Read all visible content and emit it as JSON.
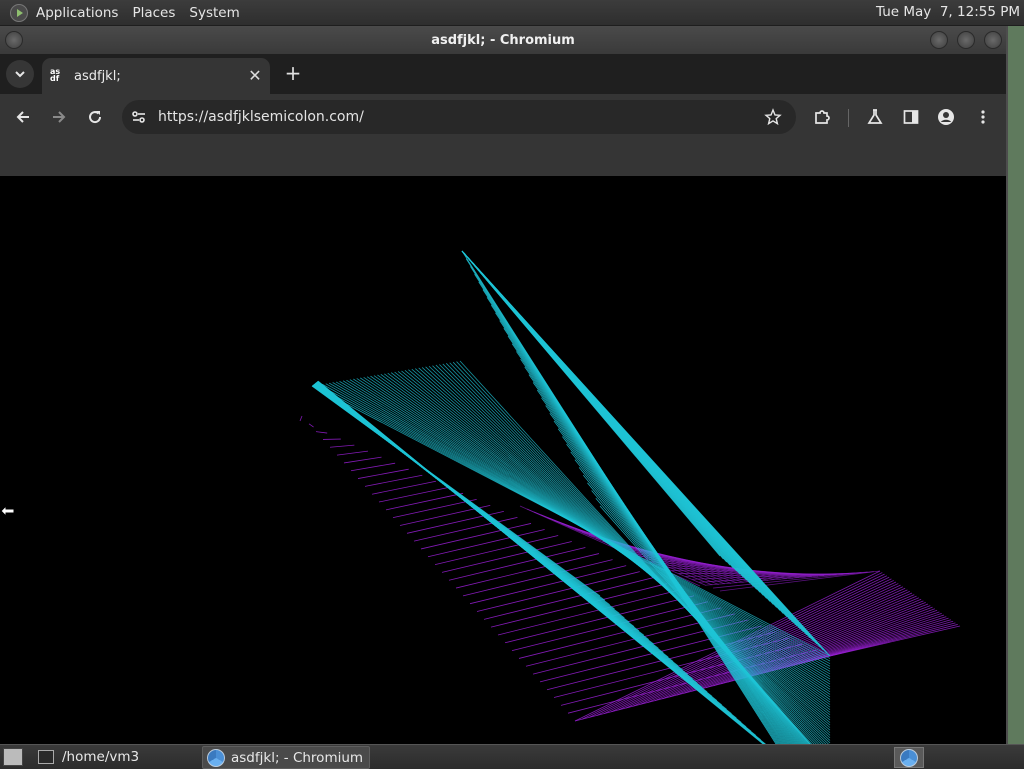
{
  "panel": {
    "menus": [
      "Applications",
      "Places",
      "System"
    ],
    "clock": "Tue May  7, 12:55 PM"
  },
  "window": {
    "title": "asdfjkl; - Chromium"
  },
  "browser": {
    "tab": {
      "title": "asdfjkl;",
      "favicon_text": "as df"
    },
    "url": "https://asdfjklsemicolon.com/"
  },
  "taskbar": {
    "items": [
      {
        "label": "/home/vm3",
        "icon": "terminal-icon"
      },
      {
        "label": "asdfjkl; - Chromium",
        "icon": "chromium-icon",
        "active": true
      }
    ]
  },
  "colors": {
    "line_cyan": "#1fc4d6",
    "line_purple": "#9a1fd6",
    "canvas_bg": "#000000"
  }
}
